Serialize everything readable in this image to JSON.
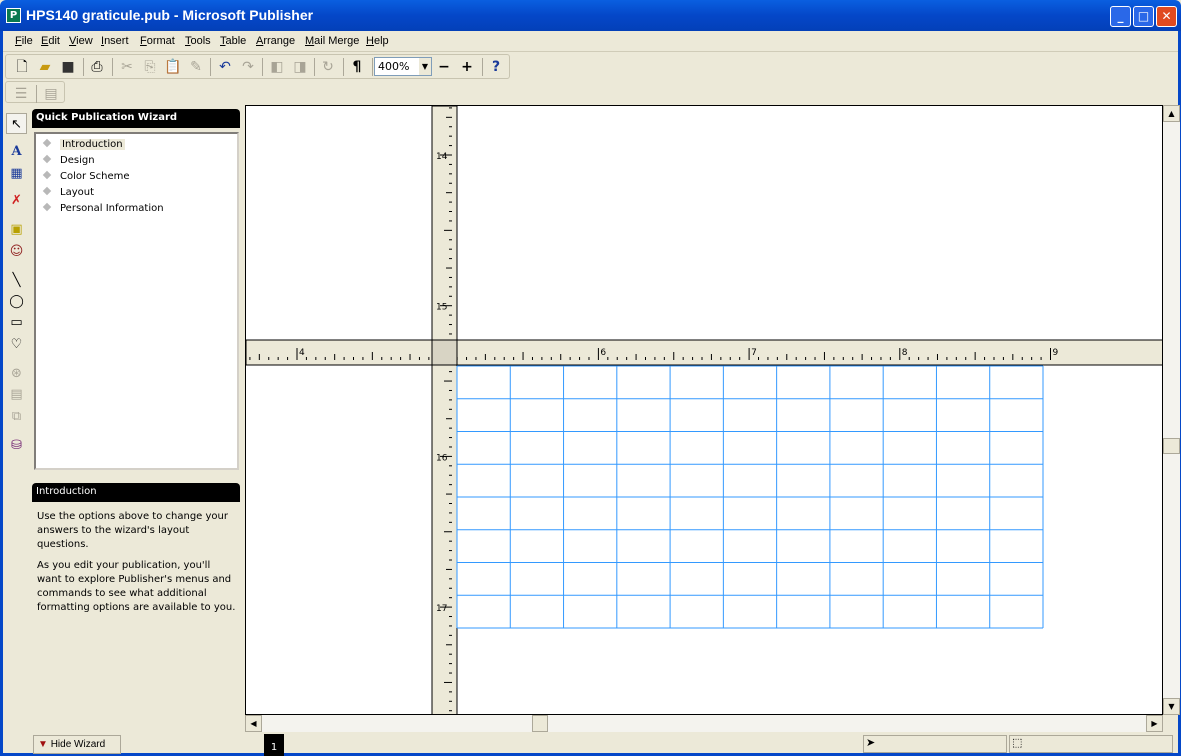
{
  "window": {
    "title": "HPS140 graticule.pub - Microsoft Publisher",
    "app_icon": "publisher-icon",
    "min": "_",
    "max": "□",
    "close": "✕"
  },
  "menu": [
    "File",
    "Edit",
    "View",
    "Insert",
    "Format",
    "Tools",
    "Table",
    "Arrange",
    "Mail Merge",
    "Help"
  ],
  "toolbar": {
    "zoom": "400%",
    "zoom_out": "−",
    "zoom_in": "+",
    "pilcrow": "¶"
  },
  "wizard": {
    "title": "Quick Publication Wizard",
    "items": [
      "Introduction",
      "Design",
      "Color Scheme",
      "Layout",
      "Personal Information"
    ],
    "selected": "Introduction",
    "section_title": "Introduction",
    "p1": "Use the options above to change your answers to the wizard's layout questions.",
    "p2": "As you edit your publication, you'll want to explore Publisher's menus and commands to see what additional formatting options are available to you."
  },
  "rulers": {
    "horizontal_labels": [
      "4",
      "6",
      "7",
      "8",
      "9"
    ],
    "vertical_labels": [
      "14",
      "15",
      "16",
      "17"
    ]
  },
  "table": {
    "columns": 11,
    "rows": 8,
    "border_color": "#3399ff"
  },
  "status": {
    "hide_wizard": "Hide Wizard",
    "page": "1"
  }
}
